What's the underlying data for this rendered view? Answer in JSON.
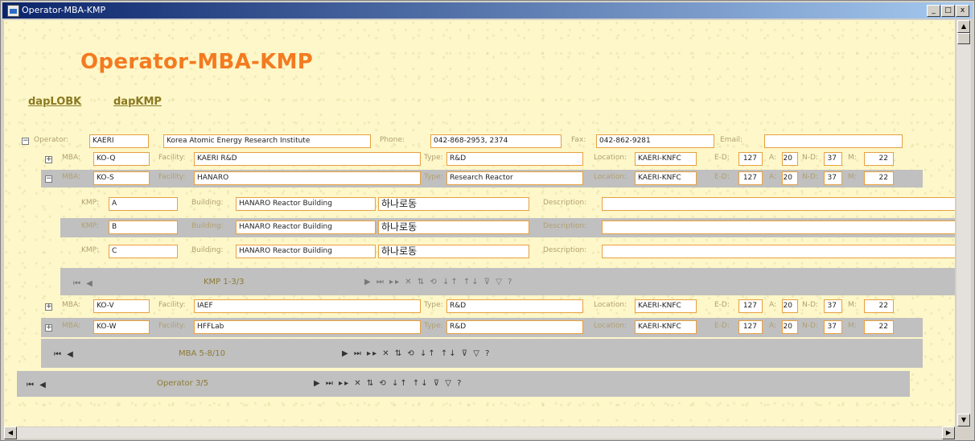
{
  "window": {
    "title": "Operator-MBA-KMP",
    "buttons": [
      "_",
      "□",
      "x"
    ]
  },
  "page": {
    "title": "Operator-MBA-KMP"
  },
  "links": [
    "dapLOBK",
    "dapKMP"
  ],
  "operator": {
    "label": "Operator:",
    "id": "KAERI",
    "name": "Korea Atomic Energy Research Institute",
    "phone_label": "Phone:",
    "phone": "042-868-2953, 2374",
    "fax_label": "Fax:",
    "fax": "042-862-9281",
    "email_label": "Email:",
    "email": ""
  },
  "mba_labels": {
    "mba": "MBA:",
    "facility": "Facility:",
    "type": "Type:",
    "location": "Location:",
    "e": "E-D:",
    "a": "A:",
    "n": "N-D:",
    "m": "M:"
  },
  "mbas": [
    {
      "mba": "KO-Q",
      "facility": "KAERI R&D",
      "type": "R&D",
      "location": "KAERI-KNFC",
      "e": "127",
      "a": "20",
      "n": "37",
      "m": "22"
    },
    {
      "mba": "KO-S",
      "facility": "HANARO",
      "type": "Research Reactor",
      "location": "KAERI-KNFC",
      "e": "127",
      "a": "20",
      "n": "37",
      "m": "22"
    },
    {
      "mba": "KO-V",
      "facility": "IAEF",
      "type": "R&D",
      "location": "KAERI-KNFC",
      "e": "127",
      "a": "20",
      "n": "37",
      "m": "22"
    },
    {
      "mba": "KO-W",
      "facility": "HFFLab",
      "type": "R&D",
      "location": "KAERI-KNFC",
      "e": "127",
      "a": "20",
      "n": "37",
      "m": "22"
    }
  ],
  "kmp_labels": {
    "kmp": "KMP:",
    "building": "Building:",
    "description": "Description:"
  },
  "kmps": [
    {
      "kmp": "A",
      "building": "HANARO Reactor Building",
      "building_kr": "하나로동",
      "description": ""
    },
    {
      "kmp": "B",
      "building": "HANARO Reactor Building",
      "building_kr": "하나로동",
      "description": ""
    },
    {
      "kmp": "C",
      "building": "HANARO Reactor Building",
      "building_kr": "하나로동",
      "description": ""
    }
  ],
  "nav": {
    "kmp": "KMP 1-3/3",
    "mba": "MBA 5-8/10",
    "operator": "Operator 3/5",
    "first_prev": "⏮ ◀",
    "tools": "▶ ⏭ ▸▸ ✕ ⇅ ⟲ ↓↑ ↑↓ ⊽ ▽ ?"
  }
}
